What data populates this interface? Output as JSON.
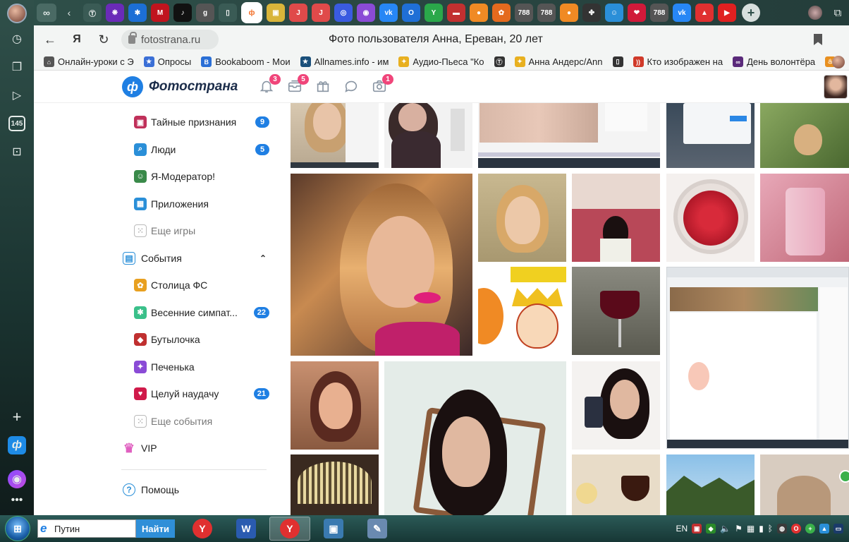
{
  "browser": {
    "tabs": [
      {
        "name": "tab-1",
        "glyph": "Ⓣ",
        "color": "#3a5b55"
      },
      {
        "name": "tab-2",
        "glyph": "❋",
        "color": "#6a2bb8"
      },
      {
        "name": "tab-3",
        "glyph": "✱",
        "color": "#1c6fd6"
      },
      {
        "name": "tab-4",
        "glyph": "M",
        "color": "#c0141e"
      },
      {
        "name": "tab-5",
        "glyph": "♪",
        "color": "#111111"
      },
      {
        "name": "tab-6",
        "glyph": "g",
        "color": "#555555"
      },
      {
        "name": "tab-7",
        "glyph": "▯",
        "color": "#3a5b55"
      },
      {
        "name": "tab-8",
        "glyph": "ф",
        "color": "#ffffff",
        "active": true
      },
      {
        "name": "tab-9",
        "glyph": "▣",
        "color": "#d9b53a"
      },
      {
        "name": "tab-10",
        "glyph": "J",
        "color": "#e04a4a"
      },
      {
        "name": "tab-11",
        "glyph": "J",
        "color": "#e04a4a"
      },
      {
        "name": "tab-12",
        "glyph": "◎",
        "color": "#3a5be0"
      },
      {
        "name": "tab-13",
        "glyph": "◉",
        "color": "#8a4bd6"
      },
      {
        "name": "tab-14",
        "glyph": "vk",
        "color": "#2787f5"
      },
      {
        "name": "tab-15",
        "glyph": "O",
        "color": "#1f6fd6"
      },
      {
        "name": "tab-16",
        "glyph": "Y",
        "color": "#2aa84a"
      },
      {
        "name": "tab-17",
        "glyph": "▬",
        "color": "#c23030"
      },
      {
        "name": "tab-18",
        "glyph": "●",
        "color": "#f08a24"
      },
      {
        "name": "tab-19",
        "glyph": "✿",
        "color": "#e46a1e"
      },
      {
        "name": "tab-20",
        "glyph": "788",
        "color": "#555555"
      },
      {
        "name": "tab-21",
        "glyph": "788",
        "color": "#555555"
      },
      {
        "name": "tab-22",
        "glyph": "●",
        "color": "#f08a24"
      },
      {
        "name": "tab-23",
        "glyph": "✤",
        "color": "#333333"
      },
      {
        "name": "tab-24",
        "glyph": "☺",
        "color": "#2a8fd8"
      },
      {
        "name": "tab-25",
        "glyph": "❤",
        "color": "#d01a3a"
      },
      {
        "name": "tab-26",
        "glyph": "788",
        "color": "#555555"
      },
      {
        "name": "tab-27",
        "glyph": "vk",
        "color": "#2787f5"
      },
      {
        "name": "tab-28",
        "glyph": "▲",
        "color": "#e03030"
      },
      {
        "name": "tab-29",
        "glyph": "▶",
        "color": "#e02020"
      }
    ],
    "url": "fotostrana.ru",
    "page_title": "Фото пользователя Анна, Ереван, 20 лет",
    "sidebar_counter": "145",
    "bookmarks": [
      {
        "label": "Онлайн-уроки с Э",
        "icon_color": "#555555",
        "glyph": "⌂"
      },
      {
        "label": "Опросы",
        "icon_color": "#3a6fd6",
        "glyph": "★"
      },
      {
        "label": "Bookaboom - Мои",
        "icon_color": "#2a6fd6",
        "glyph": "B"
      },
      {
        "label": "Allnames.info - им",
        "icon_color": "#1a4f7a",
        "glyph": "★"
      },
      {
        "label": "Аудио-Пьеса \"Ко",
        "icon_color": "#e8b020",
        "glyph": "✦"
      },
      {
        "label": "",
        "icon_color": "#333333",
        "glyph": "Ⓣ"
      },
      {
        "label": "Анна Андерс/Ann",
        "icon_color": "#e8b020",
        "glyph": "✦"
      },
      {
        "label": "",
        "icon_color": "#333333",
        "glyph": "▯"
      },
      {
        "label": "Кто изображен на",
        "icon_color": "#d03a2a",
        "glyph": "))"
      },
      {
        "label": "День волонтёра",
        "icon_color": "#5a2a7a",
        "glyph": "∞"
      },
      {
        "label": "",
        "icon_color": "#e89020",
        "glyph": "♨"
      }
    ]
  },
  "site": {
    "logo_text": "Фотострана",
    "logo_mark": "ф",
    "header_icons": [
      {
        "name": "notifications-icon",
        "badge": "3"
      },
      {
        "name": "messages-box-icon",
        "badge": "5"
      },
      {
        "name": "gifts-icon",
        "badge": ""
      },
      {
        "name": "chat-icon",
        "badge": ""
      },
      {
        "name": "photo-camera-icon",
        "badge": "1"
      }
    ],
    "menu": [
      {
        "name": "menu-item-secret-confessions",
        "label": "Тайные признания",
        "count": "9",
        "icon": "gift-icon",
        "icon_color": "#c0305a",
        "indent": true
      },
      {
        "name": "menu-item-people",
        "label": "Люди",
        "count": "5",
        "icon": "search-icon",
        "icon_color": "#2a8fd8",
        "indent": true
      },
      {
        "name": "menu-item-moderator",
        "label": "Я-Модератор!",
        "count": "",
        "icon": "moderator-icon",
        "icon_color": "#3a8a4a",
        "indent": true
      },
      {
        "name": "menu-item-apps",
        "label": "Приложения",
        "count": "",
        "icon": "gamepad-icon",
        "icon_color": "#2a8fd8",
        "indent": true
      },
      {
        "name": "menu-item-more-games",
        "label": "Еще игры",
        "count": "",
        "icon": "dice-icon",
        "icon_color": "#bbbbbb",
        "indent": true,
        "muted": true
      },
      {
        "name": "menu-item-events",
        "label": "События",
        "count": "",
        "icon": "events-icon",
        "icon_color": "#2a8fd8",
        "indent": false,
        "expandable": true
      },
      {
        "name": "menu-item-fs-capital",
        "label": "Столица ФС",
        "count": "",
        "icon": "flower-icon",
        "icon_color": "#e8a020",
        "indent": true
      },
      {
        "name": "menu-item-spring-sympathies",
        "label": "Весенние симпат...",
        "count": "22",
        "icon": "sympathy-icon",
        "icon_color": "#3ac08a",
        "indent": true
      },
      {
        "name": "menu-item-bottle",
        "label": "Бутылочка",
        "count": "",
        "icon": "bottle-icon",
        "icon_color": "#c03030",
        "indent": true
      },
      {
        "name": "menu-item-cookie",
        "label": "Печенька",
        "count": "",
        "icon": "cookie-icon",
        "icon_color": "#8a4bd6",
        "indent": true
      },
      {
        "name": "menu-item-random-kiss",
        "label": "Целуй наудачу",
        "count": "21",
        "icon": "lips-icon",
        "icon_color": "#d01a4a",
        "indent": true
      },
      {
        "name": "menu-item-more-events",
        "label": "Еще события",
        "count": "",
        "icon": "dice-icon",
        "icon_color": "#bbbbbb",
        "indent": true,
        "muted": true
      },
      {
        "name": "menu-item-vip",
        "label": "VIP",
        "count": "",
        "icon": "crown-icon",
        "icon_color": "#e060c0",
        "indent": false
      },
      {
        "name": "menu-item-help",
        "label": "Помощь",
        "count": "",
        "icon": "help-icon",
        "icon_color": "#2a8fd8",
        "indent": false
      }
    ]
  },
  "taskbar": {
    "search_value": "Путин",
    "search_button": "Найти",
    "language": "EN",
    "apps": [
      {
        "name": "taskbar-yandex-browser",
        "glyph": "Y",
        "color": "#e03030",
        "active": false
      },
      {
        "name": "taskbar-word",
        "glyph": "W",
        "color": "#2a5bb0",
        "active": false
      },
      {
        "name": "taskbar-yandex-browser-window",
        "glyph": "Y",
        "color": "#e03030",
        "active": true
      },
      {
        "name": "taskbar-photo-viewer",
        "glyph": "▣",
        "color": "#3a7ab0",
        "active": false
      },
      {
        "name": "taskbar-paint",
        "glyph": "✎",
        "color": "#6a8ab0",
        "active": false
      }
    ]
  }
}
